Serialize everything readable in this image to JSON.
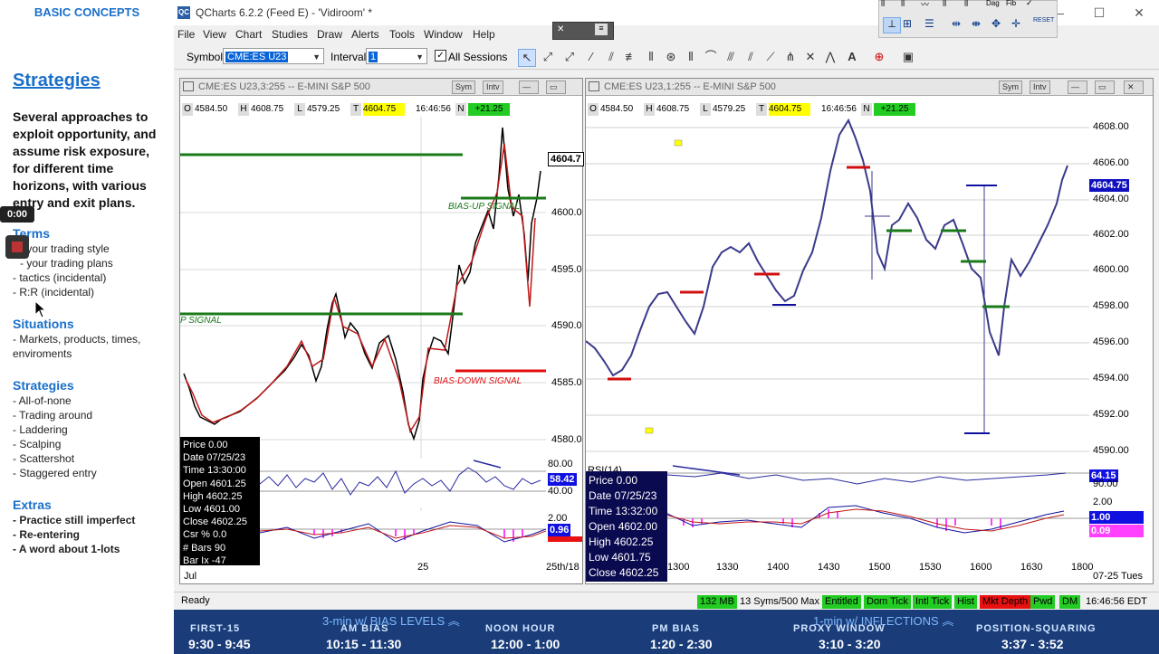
{
  "notes": {
    "header": "BASIC CONCEPTS",
    "title": "Strategies",
    "intro": "Several approaches to exploit opportunity, and assume risk exposure, for different time horizons, with various entry and exit plans.",
    "timer": "0:00",
    "terms_title": "Terms",
    "terms": [
      "- your trading style",
      "- your trading plans",
      "- tactics (incidental)",
      "- R:R (incidental)"
    ],
    "situations_title": "Situations",
    "situations": [
      "- Markets, products, times,",
      "enviroments"
    ],
    "strategies_title": "Strategies",
    "strategies": [
      "- All-of-none",
      "- Trading around",
      "- Laddering",
      "- Scalping",
      "- Scattershot",
      "- Staggered entry"
    ],
    "extras_title": "Extras",
    "extras": [
      "- Practice still imperfect",
      "- Re-entering",
      "- A word about 1-lots"
    ]
  },
  "app": {
    "title": "QCharts 6.2.2 (Feed E) - 'Vidiroom' *",
    "logo": "QC",
    "menu": [
      "File",
      "View",
      "Chart",
      "Studies",
      "Draw",
      "Alerts",
      "Tools",
      "Window",
      "Help"
    ],
    "toolbar": {
      "symbol_label": "Symbol",
      "symbol_value": "CME:ES U23",
      "interval_label": "Interval",
      "interval_value": "1",
      "all_sessions": "All Sessions"
    },
    "float_buttons": [
      "Dag",
      "Fib",
      "RESET"
    ]
  },
  "chart_left": {
    "title": "CME:ES U23,3:255 -- E-MINI S&P 500",
    "btn_sym": "Sym",
    "btn_intv": "Intv",
    "ohlc": {
      "o": "4584.50",
      "h": "4608.75",
      "l": "4579.25",
      "t": "4604.75",
      "time": "16:46:56",
      "n": "+21.25"
    },
    "price_labels": [
      "4600.0",
      "4595.0",
      "4590.0",
      "4585.0",
      "4580.0"
    ],
    "last_price": "4604.7",
    "signals": [
      "BIAS-UP SIGNAL",
      "P SIGNAL",
      "BIAS-DOWN SIGNAL"
    ],
    "ind_labels": [
      "80.00",
      "40.00",
      "2.00"
    ],
    "ind_value1": "58.42",
    "ind_value2": "0.96",
    "x_labels": [
      "Jul",
      "25",
      "25th/18"
    ],
    "info": [
      "Price  0.00",
      "Date  07/25/23",
      "Time  13:30:00",
      "Open 4601.25",
      "High  4602.25",
      "Low   4601.00",
      "Close 4602.25",
      "Csr % 0.0",
      "# Bars 90",
      "Bar Ix -47"
    ]
  },
  "chart_right": {
    "title": "CME:ES U23,1:255 -- E-MINI S&P 500",
    "btn_sym": "Sym",
    "btn_intv": "Intv",
    "ohlc": {
      "o": "4584.50",
      "h": "4608.75",
      "l": "4579.25",
      "t": "4604.75",
      "time": "16:46:56",
      "n": "+21.25"
    },
    "price_labels": [
      "4608.00",
      "4606.00",
      "4604.00",
      "4602.00",
      "4600.00",
      "4598.00",
      "4596.00",
      "4594.00",
      "4592.00",
      "4590.00"
    ],
    "last_price": "4604.75",
    "rsi_label": "RSI(14)",
    "ind_labels": [
      "90.00",
      "2.00"
    ],
    "ind_value1": "64.15",
    "ind_value2": "1.00",
    "ind_value3": "0.09",
    "x_labels": [
      "1300",
      "1330",
      "1400",
      "1430",
      "1500",
      "1530",
      "1600",
      "1630",
      "1800",
      "07-25 Tues"
    ],
    "info": [
      "Price  0.00",
      "Date  07/25/23",
      "Time  13:32:00",
      "Open  4602.00",
      "High  4602.25",
      "Low   4601.75",
      "Close 4602.25"
    ]
  },
  "status": {
    "ready": "Ready",
    "mem": "132 MB",
    "syms": "13 Syms/500 Max",
    "items": [
      "Entitled",
      "Dom Tick",
      "Intl Tick",
      "Hist"
    ],
    "mkt_depth": "Mkt Depth",
    "items2": [
      "Pwd",
      "DM"
    ],
    "time": "16:46:56 EDT"
  },
  "schedule": {
    "title_left": "3-min w/ BIAS LEVELS",
    "title_right": "1-min w/ INFLECTIONS",
    "slots": [
      {
        "name": "FIRST-15",
        "time": "9:30 - 9:45"
      },
      {
        "name": "AM BIAS",
        "time": "10:15 - 11:30"
      },
      {
        "name": "NOON HOUR",
        "time": "12:00 - 1:00"
      },
      {
        "name": "PM BIAS",
        "time": "1:20 - 2:30"
      },
      {
        "name": "PROXY WINDOW",
        "time": "3:10 - 3:20"
      },
      {
        "name": "POSITION-SQUARING",
        "time": "3:37 - 3:52"
      }
    ]
  }
}
